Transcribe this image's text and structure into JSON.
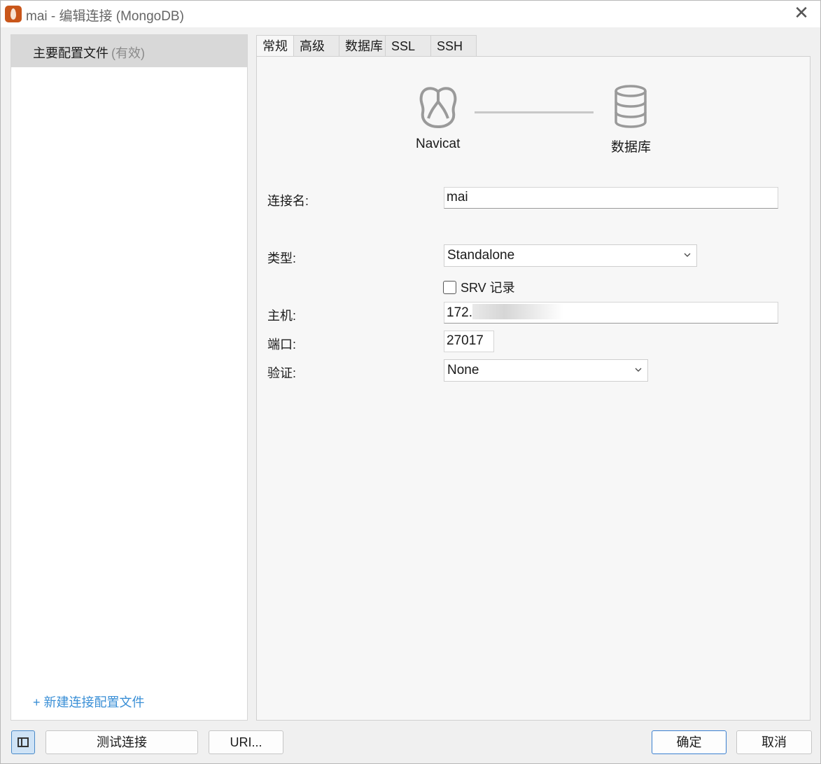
{
  "window": {
    "title": "mai - 编辑连接 (MongoDB)",
    "close_glyph": "✕"
  },
  "sidebar": {
    "profile_label": "主要配置文件",
    "profile_status": "(有效)",
    "new_profile_link": "+ 新建连接配置文件"
  },
  "tabs": [
    {
      "label": "常规",
      "active": true
    },
    {
      "label": "高级",
      "active": false
    },
    {
      "label": "数据库",
      "active": false
    },
    {
      "label": "SSL",
      "active": false
    },
    {
      "label": "SSH",
      "active": false
    }
  ],
  "diagram": {
    "left_label": "Navicat",
    "right_label": "数据库"
  },
  "form": {
    "connection_name_label": "连接名:",
    "connection_name_value": "mai",
    "type_label": "类型:",
    "type_value": "Standalone",
    "srv_label": "SRV 记录",
    "srv_checked": false,
    "host_label": "主机:",
    "host_value": "172.",
    "port_label": "端口:",
    "port_value": "27017",
    "auth_label": "验证:",
    "auth_value": "None"
  },
  "footer": {
    "test_button": "测试连接",
    "uri_button": "URI...",
    "ok_button": "确定",
    "cancel_button": "取消"
  },
  "colors": {
    "accent": "#3a7fd0",
    "link": "#3a8fd6",
    "app_icon": "#c9561a"
  },
  "icons": {
    "app": "mongodb-leaf-icon",
    "close": "close-icon",
    "navicat": "navicat-logo-icon",
    "database": "database-icon",
    "dropdown": "chevron-down-icon",
    "sidebar_toggle": "sidebar-toggle-icon"
  }
}
